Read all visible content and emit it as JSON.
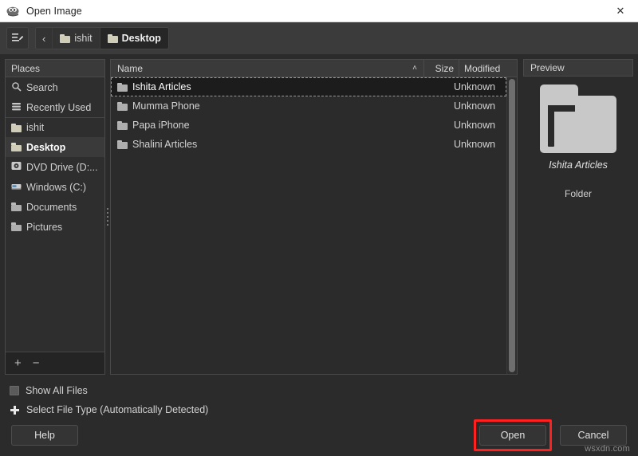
{
  "window": {
    "title": "Open Image",
    "app_icon": "gimp-wilber-icon",
    "close_label": "✕"
  },
  "toolbar": {
    "type_location_icon": "type-a-file-name-icon",
    "back_label": "‹",
    "breadcrumbs": [
      {
        "label": "ishit",
        "active": false
      },
      {
        "label": "Desktop",
        "active": true
      }
    ]
  },
  "places": {
    "header": "Places",
    "items": [
      {
        "label": "Search",
        "icon": "search-icon",
        "selected": false,
        "group_top": false
      },
      {
        "label": "Recently Used",
        "icon": "recent-icon",
        "selected": false,
        "group_top": false
      },
      {
        "label": "ishit",
        "icon": "folder-icon",
        "selected": false,
        "group_top": true
      },
      {
        "label": "Desktop",
        "icon": "folder-icon",
        "selected": true,
        "group_top": false
      },
      {
        "label": "DVD Drive (D:...",
        "icon": "dvd-drive-icon",
        "selected": false,
        "group_top": false
      },
      {
        "label": "Windows (C:)",
        "icon": "hard-drive-icon",
        "selected": false,
        "group_top": false
      },
      {
        "label": "Documents",
        "icon": "folder-icon",
        "selected": false,
        "group_top": false
      },
      {
        "label": "Pictures",
        "icon": "folder-icon",
        "selected": false,
        "group_top": false
      }
    ],
    "add_label": "+",
    "remove_label": "−"
  },
  "filelist": {
    "columns": {
      "name": "Name",
      "size": "Size",
      "modified": "Modified"
    },
    "sort_arrow": "˄",
    "rows": [
      {
        "name": "Ishita Articles",
        "size": "",
        "modified": "Unknown",
        "selected": true
      },
      {
        "name": "Mumma Phone",
        "size": "",
        "modified": "Unknown",
        "selected": false
      },
      {
        "name": "Papa iPhone",
        "size": "",
        "modified": "Unknown",
        "selected": false
      },
      {
        "name": "Shalini Articles",
        "size": "",
        "modified": "Unknown",
        "selected": false
      }
    ]
  },
  "preview": {
    "header": "Preview",
    "name": "Ishita Articles",
    "type": "Folder",
    "icon": "folder-icon-large"
  },
  "options": {
    "show_all_files": "Show All Files",
    "select_file_type": "Select File Type (Automatically Detected)"
  },
  "footer": {
    "help": "Help",
    "open": "Open",
    "cancel": "Cancel"
  },
  "watermark": "wsxdn.com",
  "colors": {
    "window_bg": "#2b2b2b",
    "panel_bg": "#2e2e2e",
    "header_bg": "#3a3a3a",
    "titlebar_bg": "#ffffff",
    "selected_row_bg": "#1c1c1c",
    "highlight_red": "#ff2020",
    "text": "#d2d2d2",
    "folder_yellow": "#cfccb8"
  }
}
